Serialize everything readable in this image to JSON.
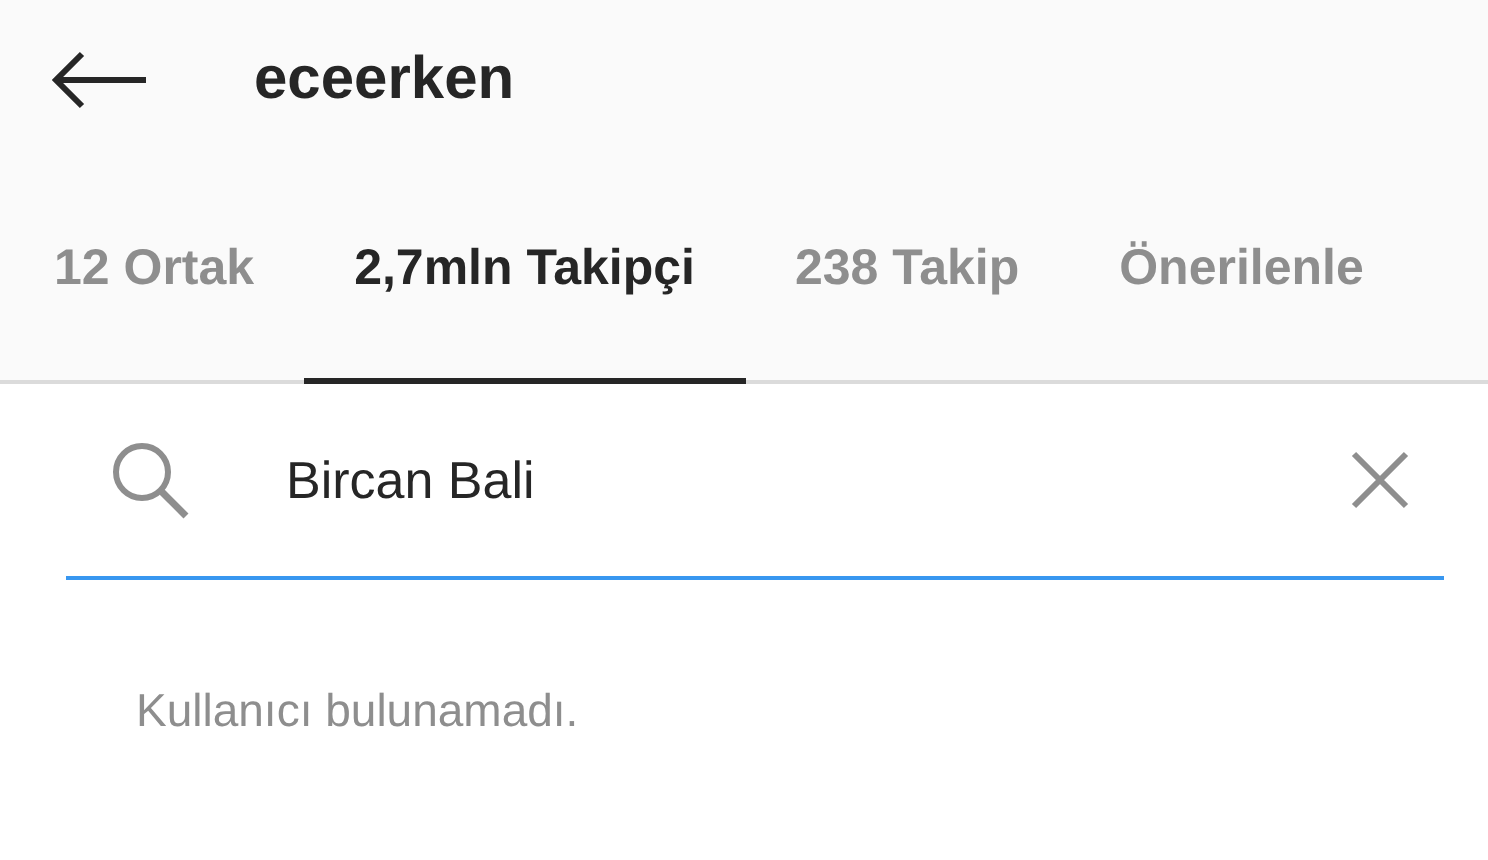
{
  "header": {
    "title": "eceerken"
  },
  "tabs": [
    {
      "label": "12 Ortak",
      "selected": false
    },
    {
      "label": "2,7mln Takipçi",
      "selected": true
    },
    {
      "label": "238 Takip",
      "selected": false
    },
    {
      "label": "Önerilenle",
      "selected": false
    }
  ],
  "search": {
    "value": "Bircan Bali"
  },
  "message": "Kullanıcı bulunamadı."
}
